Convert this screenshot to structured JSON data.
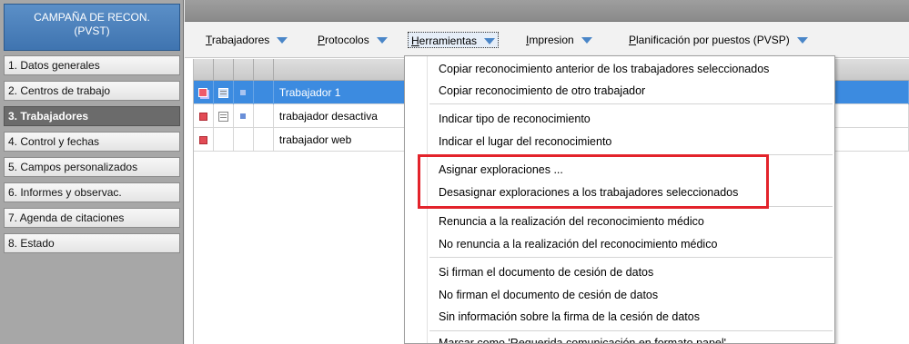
{
  "sidebar": {
    "header": {
      "line1": "CAMPAÑA DE RECON.",
      "line2": "(PVST)"
    },
    "items": [
      {
        "label": "1. Datos generales",
        "active": false
      },
      {
        "label": "2. Centros de trabajo",
        "active": false
      },
      {
        "label": "3. Trabajadores",
        "active": true
      },
      {
        "label": "4. Control y fechas",
        "active": false
      },
      {
        "label": "5. Campos personalizados",
        "active": false
      },
      {
        "label": "6. Informes y observac.",
        "active": false
      },
      {
        "label": "7. Agenda de citaciones",
        "active": false
      },
      {
        "label": "8. Estado",
        "active": false
      }
    ]
  },
  "toolbar": {
    "menus": [
      {
        "label": "Trabajadores",
        "mnemonic": "T",
        "rest": "rabajadores"
      },
      {
        "label": "Protocolos",
        "mnemonic": "P",
        "rest": "rotocolos"
      },
      {
        "label": "Herramientas",
        "mnemonic": "H",
        "rest": "erramientas",
        "open": true
      },
      {
        "label": "Impresion",
        "mnemonic": "I",
        "rest": "mpresion"
      },
      {
        "label": "Planificación por puestos (PVSP)",
        "mnemonic": "P",
        "rest": "lanificación por puestos (PVSP)"
      }
    ]
  },
  "grid": {
    "rows": [
      {
        "name": "Trabajador 1",
        "selected": true
      },
      {
        "name": "trabajador desactiva",
        "selected": false
      },
      {
        "name": "trabajador web",
        "selected": false
      }
    ]
  },
  "menu": {
    "items": [
      "Copiar reconocimiento anterior de los trabajadores seleccionados",
      "Copiar reconocimiento de otro trabajador",
      "Indicar tipo de reconocimiento",
      "Indicar el lugar del reconocimiento",
      "Asignar exploraciones ...",
      "Desasignar exploraciones a los trabajadores seleccionados",
      "Renuncia a la realización del reconocimiento médico",
      "No renuncia a la realización del reconocimiento médico",
      "Si firman el documento de cesión de datos",
      "No firman el documento de cesión de datos",
      "Sin información sobre la firma de la cesión de datos",
      "Marcar como 'Requerida comunicación en formato papel'"
    ]
  },
  "colors": {
    "accent": "#3c8be0",
    "highlight": "#e3232b",
    "sidebar_header": "#4a80bd"
  }
}
